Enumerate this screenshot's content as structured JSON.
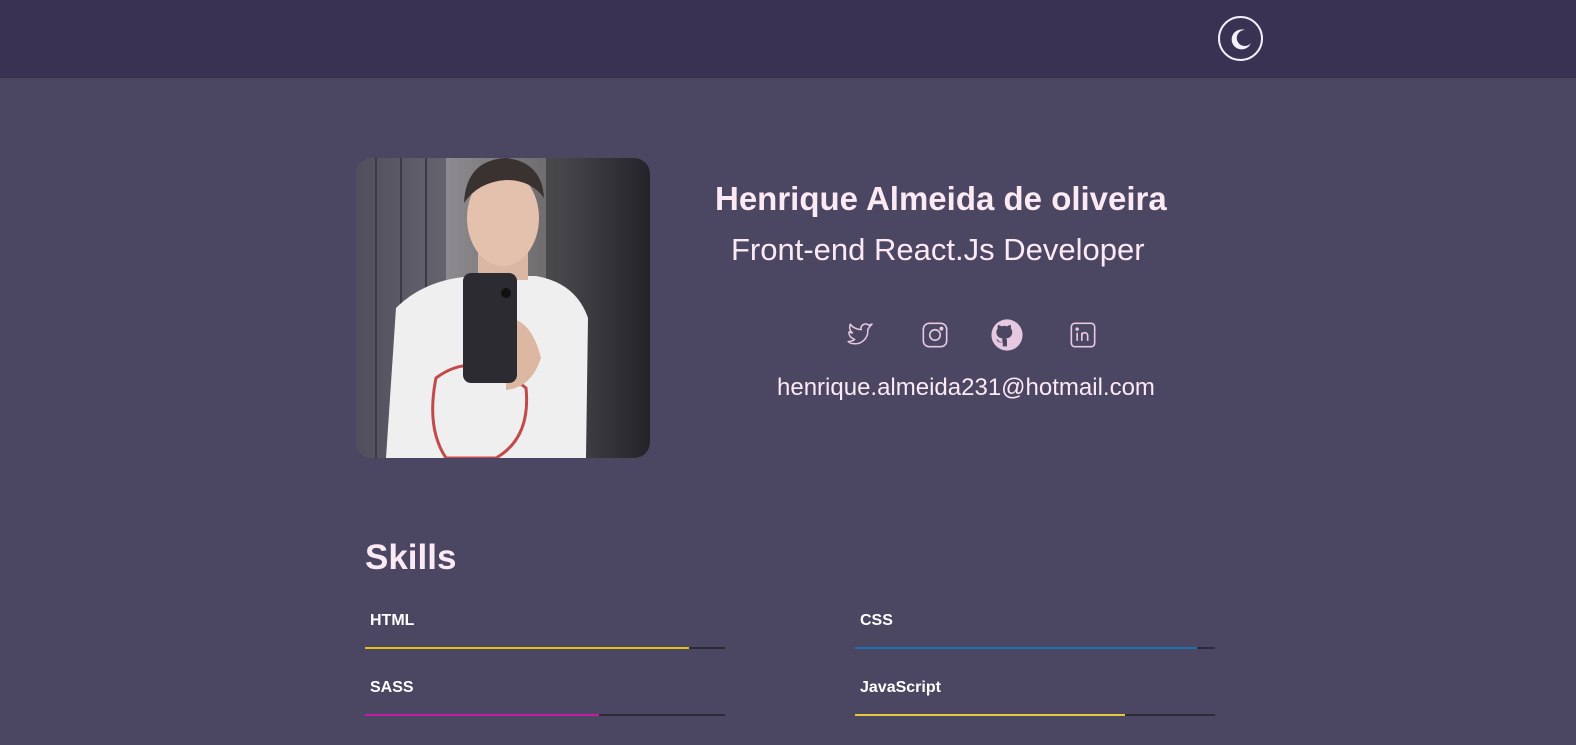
{
  "header": {
    "theme_icon": "moon-icon"
  },
  "profile": {
    "name": "Henrique Almeida de oliveira",
    "role": "Front-end React.Js Developer",
    "email": "henrique.almeida231@hotmail.com",
    "avatar_alt": "profile photo"
  },
  "socials": [
    {
      "name": "twitter",
      "icon": "twitter-icon"
    },
    {
      "name": "instagram",
      "icon": "instagram-icon"
    },
    {
      "name": "github",
      "icon": "github-icon"
    },
    {
      "name": "linkedin",
      "icon": "linkedin-icon"
    }
  ],
  "skills": {
    "title": "Skills",
    "items": [
      {
        "label": "HTML",
        "level": 0.9,
        "color": "#e2c11a"
      },
      {
        "label": "CSS",
        "level": 0.95,
        "color": "#1f6fb8"
      },
      {
        "label": "SASS",
        "level": 0.65,
        "color": "#c41ca8"
      },
      {
        "label": "JavaScript",
        "level": 0.75,
        "color": "#e8c83a"
      }
    ]
  },
  "colors": {
    "page_bg": "#4b4661",
    "topbar_bg": "#393252",
    "text": "#fbe9f4",
    "icon": "#e6c8e0"
  }
}
